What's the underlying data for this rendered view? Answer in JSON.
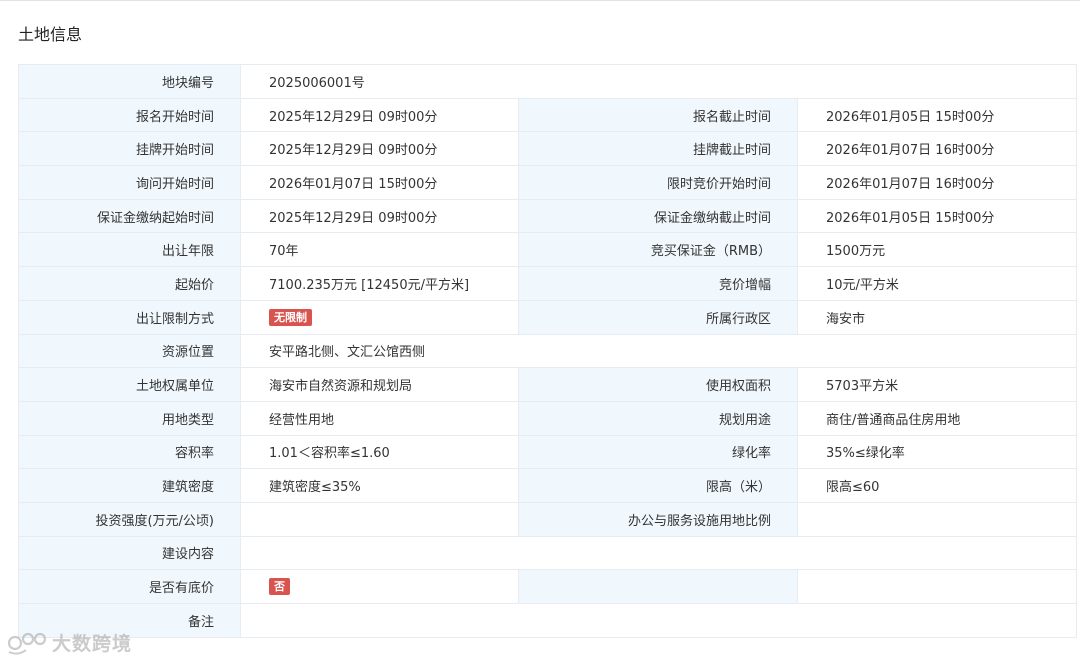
{
  "section": {
    "title": "土地信息"
  },
  "rows": {
    "parcel_no": {
      "label": "地块编号",
      "value": "2025006001号"
    },
    "signup_start": {
      "label": "报名开始时间",
      "value": "2025年12月29日 09时00分"
    },
    "signup_end": {
      "label": "报名截止时间",
      "value": "2026年01月05日 15时00分"
    },
    "listing_start": {
      "label": "挂牌开始时间",
      "value": "2025年12月29日 09时00分"
    },
    "listing_end": {
      "label": "挂牌截止时间",
      "value": "2026年01月07日 16时00分"
    },
    "inquiry_start": {
      "label": "询问开始时间",
      "value": "2026年01月07日 15时00分"
    },
    "timed_bid_start": {
      "label": "限时竞价开始时间",
      "value": "2026年01月07日 16时00分"
    },
    "deposit_start": {
      "label": "保证金缴纳起始时间",
      "value": "2025年12月29日 09时00分"
    },
    "deposit_end": {
      "label": "保证金缴纳截止时间",
      "value": "2026年01月05日 15时00分"
    },
    "term": {
      "label": "出让年限",
      "value": "70年"
    },
    "bid_deposit": {
      "label": "竞买保证金（RMB）",
      "value": "1500万元"
    },
    "start_price": {
      "label": "起始价",
      "value": "7100.235万元 [12450元/平方米]"
    },
    "bid_increment": {
      "label": "竞价增幅",
      "value": "10元/平方米"
    },
    "restriction": {
      "label": "出让限制方式",
      "badge": "无限制"
    },
    "district": {
      "label": "所属行政区",
      "value": "海安市"
    },
    "location": {
      "label": "资源位置",
      "value": "安平路北侧、文汇公馆西侧"
    },
    "owner": {
      "label": "土地权属单位",
      "value": "海安市自然资源和规划局"
    },
    "area": {
      "label": "使用权面积",
      "value": "5703平方米"
    },
    "land_type": {
      "label": "用地类型",
      "value": "经营性用地"
    },
    "planned_use": {
      "label": "规划用途",
      "value": "商住/普通商品住房用地"
    },
    "plot_ratio": {
      "label": "容积率",
      "value": "1.01＜容积率≤1.60"
    },
    "green_ratio": {
      "label": "绿化率",
      "value": "35%≤绿化率"
    },
    "building_density": {
      "label": "建筑密度",
      "value": "建筑密度≤35%"
    },
    "height_limit": {
      "label": "限高（米）",
      "value": "限高≤60"
    },
    "investment": {
      "label": "投资强度(万元/公顷)",
      "value": ""
    },
    "office_ratio": {
      "label": "办公与服务设施用地比例",
      "value": ""
    },
    "construction": {
      "label": "建设内容",
      "value": ""
    },
    "reserve_price": {
      "label": "是否有底价",
      "badge": "否"
    },
    "remarks": {
      "label": "备注",
      "value": ""
    }
  },
  "watermark": {
    "text": "大数跨境"
  },
  "colors": {
    "label_bg": "#f1f8fd",
    "border": "#e6ecf2",
    "badge_red": "#d9534f"
  }
}
